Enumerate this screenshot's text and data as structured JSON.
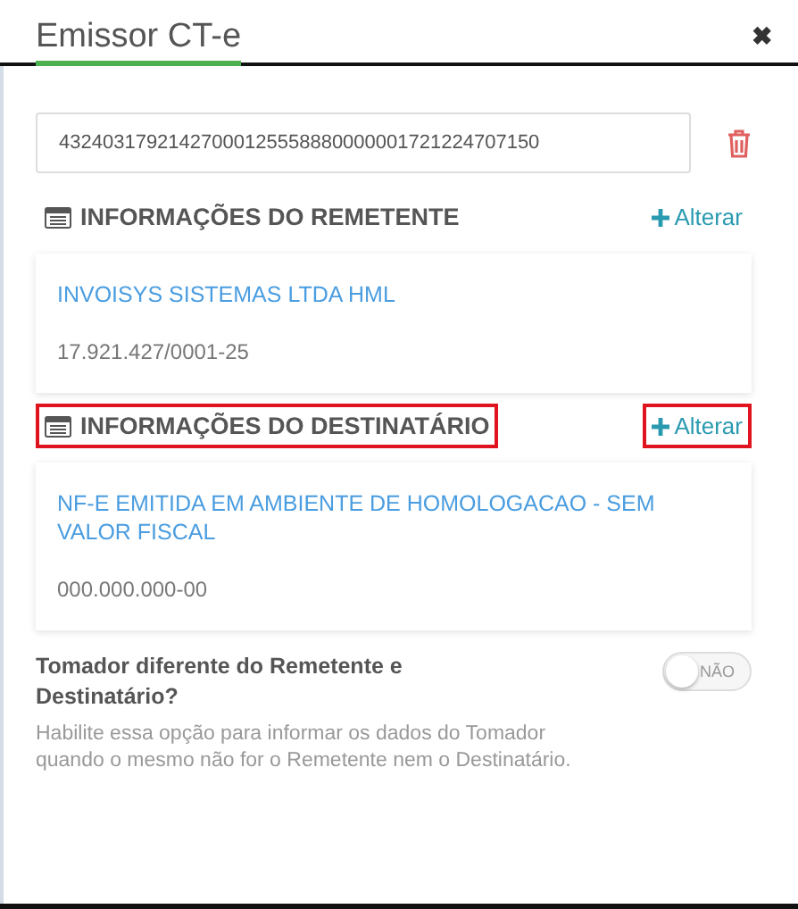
{
  "window": {
    "title": "Emissor CT-e",
    "close": "✖"
  },
  "access_key": {
    "value": "43240317921427000125558880000001721224707150"
  },
  "sections": [
    {
      "title": "INFORMAÇÕES DO REMETENTE",
      "action": "Alterar",
      "highlighted": false,
      "name": "INVOISYS SISTEMAS LTDA HML",
      "document": "17.921.427/0001-25"
    },
    {
      "title": "INFORMAÇÕES DO DESTINATÁRIO",
      "action": "Alterar",
      "highlighted": true,
      "name": "NF-E EMITIDA EM AMBIENTE DE HOMOLOGACAO - SEM VALOR FISCAL",
      "document": "000.000.000-00"
    }
  ],
  "tomador": {
    "label": "Tomador diferente do Remetente e Destinatário?",
    "help": "Habilite essa opção para informar os dados do Tomador quando o mesmo não for o Remetente nem o Destinatário.",
    "toggle": {
      "on": false,
      "text": "NÃO"
    }
  }
}
